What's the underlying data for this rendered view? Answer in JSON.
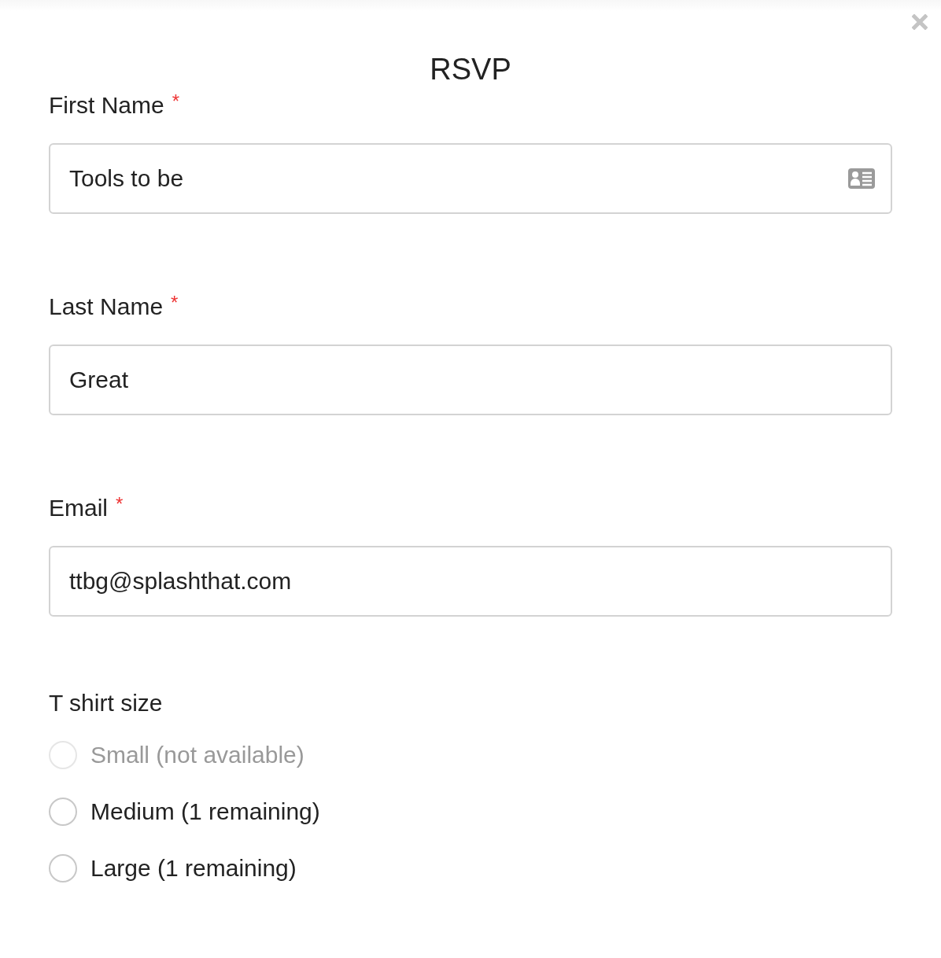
{
  "dialog": {
    "title": "RSVP"
  },
  "fields": [
    {
      "label": "First Name",
      "required_mark": "*",
      "value": "Tools to be",
      "autofill_icon": true
    },
    {
      "label": "Last Name",
      "required_mark": "*",
      "value": "Great",
      "autofill_icon": false
    },
    {
      "label": "Email",
      "required_mark": "*",
      "value": "ttbg@splashthat.com",
      "autofill_icon": false
    }
  ],
  "tshirt": {
    "label": "T shirt size",
    "options": [
      {
        "label": "Small (not available)",
        "selected": false,
        "disabled": true
      },
      {
        "label": "Medium (1 remaining)",
        "selected": false,
        "disabled": false
      },
      {
        "label": "Large (1 remaining)",
        "selected": false,
        "disabled": false
      }
    ]
  }
}
